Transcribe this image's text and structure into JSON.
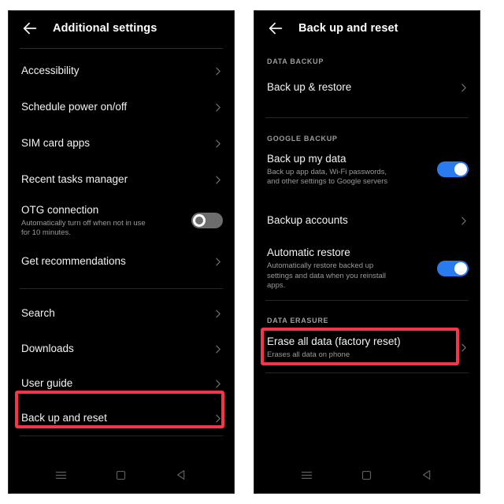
{
  "left_screen": {
    "header": {
      "back_icon": "arrow-left-icon",
      "title": "Additional settings"
    },
    "items": [
      {
        "label": "Accessibility",
        "chevron": "chevron-right-icon"
      },
      {
        "label": "Schedule power on/off",
        "chevron": "chevron-right-icon"
      },
      {
        "label": "SIM card apps",
        "chevron": "chevron-right-icon"
      },
      {
        "label": "Recent tasks manager",
        "chevron": "chevron-right-icon"
      },
      {
        "label": "OTG connection",
        "sub": "Automatically turn off when not in use for 10 minutes.",
        "toggle": "off"
      },
      {
        "label": "Get recommendations",
        "chevron": "chevron-right-icon"
      },
      {
        "label": "Search",
        "chevron": "chevron-right-icon"
      },
      {
        "label": "Downloads",
        "chevron": "chevron-right-icon"
      },
      {
        "label": "User guide",
        "chevron": "chevron-right-icon"
      },
      {
        "label": "Back up and reset",
        "chevron": "chevron-right-icon",
        "highlighted": true
      }
    ],
    "navbar": {
      "menu": "menu-icon",
      "home": "home-square-icon",
      "back": "back-triangle-icon"
    }
  },
  "right_screen": {
    "header": {
      "back_icon": "arrow-left-icon",
      "title": "Back up and reset"
    },
    "sections": [
      {
        "label": "DATA BACKUP",
        "items": [
          {
            "label": "Back up & restore",
            "chevron": "chevron-right-icon"
          }
        ]
      },
      {
        "label": "GOOGLE BACKUP",
        "items": [
          {
            "label": "Back up my data",
            "sub": "Back up app data, Wi-Fi passwords, and other settings to Google servers",
            "toggle": "on"
          },
          {
            "label": "Backup accounts",
            "chevron": "chevron-right-icon"
          },
          {
            "label": "Automatic restore",
            "sub": "Automatically restore backed up settings and data when you reinstall apps.",
            "toggle": "on"
          }
        ]
      },
      {
        "label": "DATA ERASURE",
        "items": [
          {
            "label": "Erase all data (factory reset)",
            "sub": "Erases all data on phone",
            "chevron": "chevron-right-icon",
            "highlighted": true
          }
        ]
      }
    ],
    "navbar": {
      "menu": "menu-icon",
      "home": "home-square-icon",
      "back": "back-triangle-icon"
    }
  },
  "annotations": {
    "highlight_color": "#f8344a",
    "boxes": [
      {
        "target": "Back up and reset"
      },
      {
        "target": "Erase all data (factory reset)"
      }
    ]
  },
  "theme": {
    "background": "#000000",
    "surface": "#000000",
    "text_primary": "#f3f3f3",
    "text_secondary": "#9a9a9a",
    "accent_toggle_on": "#2a7bf0",
    "toggle_off": "#6d6d6d",
    "divider": "#262626"
  }
}
